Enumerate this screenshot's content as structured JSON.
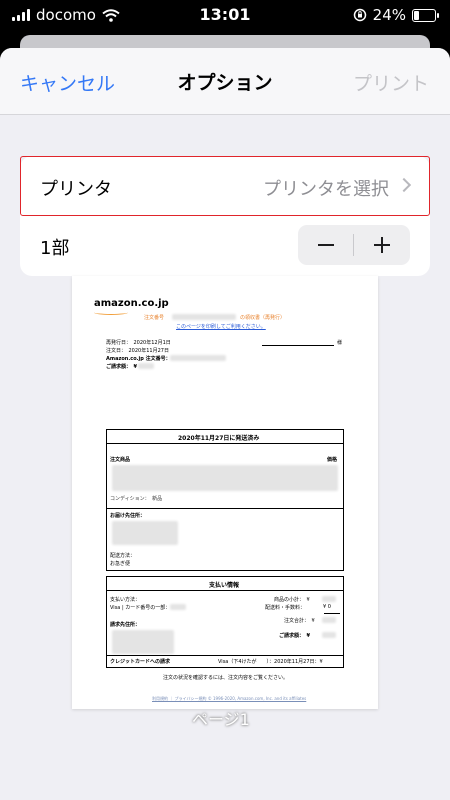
{
  "status_bar": {
    "carrier": "docomo",
    "time": "13:01",
    "battery": "24%",
    "battery_level": 0.24
  },
  "nav": {
    "cancel": "キャンセル",
    "title": "オプション",
    "print": "プリント"
  },
  "printer": {
    "label": "プリンタ",
    "value": "プリンタを選択"
  },
  "copies": {
    "label": "1部",
    "minus": "−",
    "plus": "+"
  },
  "preview": {
    "logo": "amazon.co.jp",
    "title_prefix": "注文番号",
    "title_suffix": "の領収書（再発行）",
    "print_link": "このページを印刷してご利用ください。",
    "reissue_date": "再発行日：　2020年12月1日",
    "honorific": "様",
    "order_date": "注文日：　2020年11月27日",
    "order_number": "Amazon.co.jp 注文番号：",
    "billing_amount": "ご請求額：　¥",
    "shipped_heading": "2020年11月27日に発送済み",
    "ordered_items": "注文商品",
    "price_col": "価格",
    "condition": "コンディション：　新品",
    "ship_to": "お届け先住所：",
    "ship_method": "配送方法：",
    "ship_method_value": "お急ぎ便",
    "payment_heading": "支払い情報",
    "payment_method": "支払い方法：",
    "card": "Visa | カード番号の一部：",
    "billing_address": "請求先住所：",
    "subtotal": "商品の小計：　¥",
    "shipping_fee": "配送料・手数料：",
    "shipping_fee_value": "¥ 0",
    "order_total": "注文合計：　¥",
    "grand_total": "ご請求額：　¥",
    "credit_card_billing": "クレジットカードへの請求",
    "credit_card_detail": "Visa（下4けたが　　）：2020年11月27日：¥",
    "footer_note": "注文の状況を確認するには、注文内容をご覧ください。",
    "footer_links": "利用規約 ｜ プライバシー規約 © 1996-2020, Amazon.com, Inc. and its affiliates",
    "page_label": "ページ1"
  }
}
